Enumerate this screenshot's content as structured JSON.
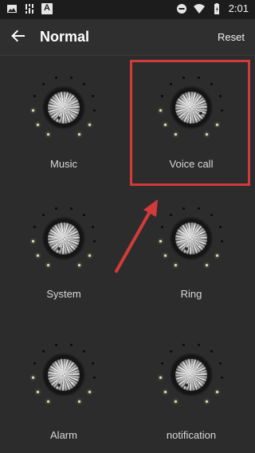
{
  "status_bar": {
    "time": "2:01",
    "icons": [
      "image-icon",
      "equalizer-icon",
      "a-badge-icon",
      "do-not-disturb-icon",
      "wifi-icon",
      "battery-icon"
    ],
    "a_badge_text": "A"
  },
  "toolbar": {
    "title": "Normal",
    "reset_label": "Reset"
  },
  "channels": [
    {
      "label": "Music"
    },
    {
      "label": "Voice call"
    },
    {
      "label": "System"
    },
    {
      "label": "Ring"
    },
    {
      "label": "Alarm"
    },
    {
      "label": "notification"
    }
  ],
  "colors": {
    "background": "#2c2c2c",
    "indicator_on": "#e9e6b5",
    "indicator_off": "#0a0a0a",
    "highlight": "#d33b3b"
  }
}
